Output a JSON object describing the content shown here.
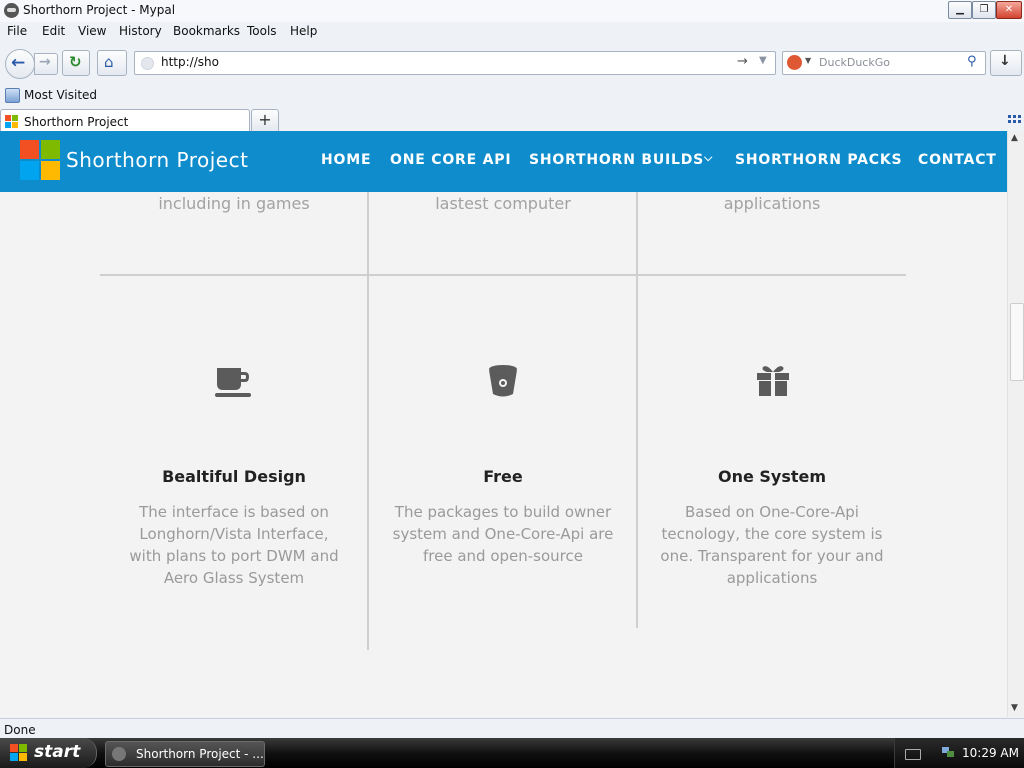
{
  "window": {
    "title": "Shorthorn Project - Mypal",
    "controls": {
      "minimize": "▁",
      "restore": "❐",
      "close": "✕"
    }
  },
  "menu": [
    "File",
    "Edit",
    "View",
    "History",
    "Bookmarks",
    "Tools",
    "Help"
  ],
  "navbar": {
    "url": "http://sho",
    "search_placeholder": "DuckDuckGo",
    "icons": [
      "back-arrow-icon",
      "forward-arrow-icon",
      "reload-icon",
      "home-icon",
      "go-arrow-icon",
      "search-icon",
      "download-icon"
    ]
  },
  "bookmarks": {
    "most_visited": "Most Visited"
  },
  "tabs": {
    "active_title": "Shorthorn Project",
    "new_tab": "+"
  },
  "site": {
    "title": "Shorthorn Project",
    "nav": [
      {
        "label": "HOME"
      },
      {
        "label": "ONE CORE API"
      },
      {
        "label": "SHORTHORN BUILDS",
        "dropdown": "⌵"
      },
      {
        "label": "SHORTHORN PACKS"
      },
      {
        "label": "CONTACT"
      }
    ],
    "top_fragments": [
      "including in games",
      "lastest computer",
      "applications"
    ],
    "features": [
      {
        "icon": "coffee-cup-icon",
        "title": "Bealtiful Design",
        "lines": [
          "The interface is based on",
          "Longhorn/Vista Interface,",
          "with plans to port DWM and",
          "Aero Glass System"
        ]
      },
      {
        "icon": "bucket-icon",
        "title": "Free",
        "lines": [
          "The packages to build owner",
          "system and One-Core-Api are",
          "free and open-source"
        ]
      },
      {
        "icon": "gift-icon",
        "title": "One System",
        "lines": [
          "Based on One-Core-Api",
          "tecnology, the core system is",
          "one. Transparent for your and",
          "applications"
        ]
      }
    ],
    "colors": {
      "header": "#0f8ccc",
      "background": "#f3f3f3",
      "divider": "#cfcfcf"
    }
  },
  "status": {
    "text": "Done"
  },
  "taskbar": {
    "start": "start",
    "item": "Shorthorn Project - ...",
    "clock": "10:29 AM"
  }
}
